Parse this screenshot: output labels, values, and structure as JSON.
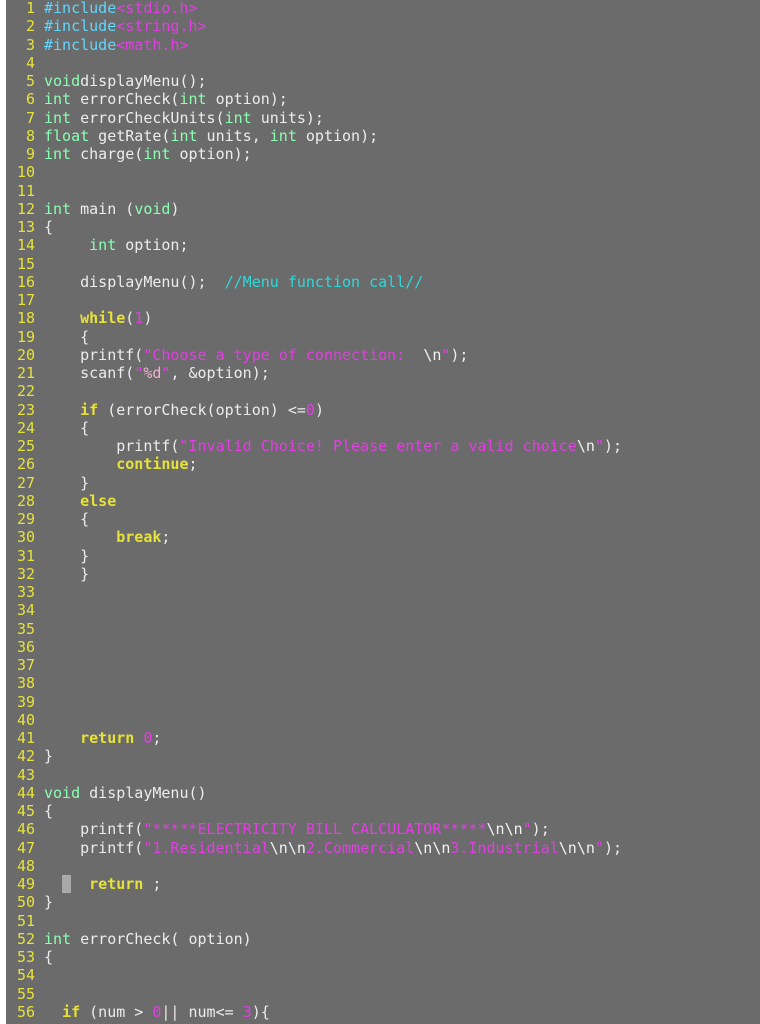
{
  "colors": {
    "background": "#6b6b6b",
    "line_number": "#e6e23a",
    "preprocessor": "#5fd7ff",
    "string": "#e23ee2",
    "type": "#8affb2",
    "statement": "#e6e23a",
    "comment": "#2ed8d8",
    "text": "#ececec"
  },
  "editor": {
    "lines": [
      {
        "n": "1",
        "s": [
          [
            "pp",
            "#include"
          ],
          [
            "str",
            "<stdio.h>"
          ]
        ]
      },
      {
        "n": "2",
        "s": [
          [
            "pp",
            "#include"
          ],
          [
            "str",
            "<string.h>"
          ]
        ]
      },
      {
        "n": "3",
        "s": [
          [
            "pp",
            "#include"
          ],
          [
            "str",
            "<math.h>"
          ]
        ]
      },
      {
        "n": "4",
        "s": []
      },
      {
        "n": "5",
        "s": [
          [
            "type",
            "void"
          ],
          [
            "",
            "displayMenu();"
          ]
        ]
      },
      {
        "n": "6",
        "s": [
          [
            "type",
            "int"
          ],
          [
            "",
            " errorCheck("
          ],
          [
            "type",
            "int"
          ],
          [
            "",
            " option);"
          ]
        ]
      },
      {
        "n": "7",
        "s": [
          [
            "type",
            "int"
          ],
          [
            "",
            " errorCheckUnits("
          ],
          [
            "type",
            "int"
          ],
          [
            "",
            " units);"
          ]
        ]
      },
      {
        "n": "8",
        "s": [
          [
            "type",
            "float"
          ],
          [
            "",
            " getRate("
          ],
          [
            "type",
            "int"
          ],
          [
            "",
            " units, "
          ],
          [
            "type",
            "int"
          ],
          [
            "",
            " option);"
          ]
        ]
      },
      {
        "n": "9",
        "s": [
          [
            "type",
            "int"
          ],
          [
            "",
            " charge("
          ],
          [
            "type",
            "int"
          ],
          [
            "",
            " option);"
          ]
        ]
      },
      {
        "n": "10",
        "s": []
      },
      {
        "n": "11",
        "s": []
      },
      {
        "n": "12",
        "s": [
          [
            "type",
            "int"
          ],
          [
            "",
            " main ("
          ],
          [
            "type",
            "void"
          ],
          [
            "",
            ")"
          ]
        ]
      },
      {
        "n": "13",
        "s": [
          [
            "",
            "{"
          ]
        ]
      },
      {
        "n": "14",
        "s": [
          [
            "",
            "     "
          ],
          [
            "type",
            "int"
          ],
          [
            "",
            " option;"
          ]
        ]
      },
      {
        "n": "15",
        "s": []
      },
      {
        "n": "16",
        "s": [
          [
            "",
            "    displayMenu();  "
          ],
          [
            "com",
            "//Menu function call//"
          ]
        ]
      },
      {
        "n": "17",
        "s": []
      },
      {
        "n": "18",
        "s": [
          [
            "",
            "    "
          ],
          [
            "kw",
            "while"
          ],
          [
            "",
            "("
          ],
          [
            "str",
            "1"
          ],
          [
            "",
            ")"
          ]
        ]
      },
      {
        "n": "19",
        "s": [
          [
            "",
            "    {"
          ]
        ]
      },
      {
        "n": "20",
        "s": [
          [
            "",
            "    printf("
          ],
          [
            "str",
            "\"Choose a type of connection:  "
          ],
          [
            "sp",
            "\\n"
          ],
          [
            "str",
            "\""
          ],
          [
            "",
            ");"
          ]
        ]
      },
      {
        "n": "21",
        "s": [
          [
            "",
            "    scanf("
          ],
          [
            "str",
            "\""
          ],
          [
            "fmt",
            "%d"
          ],
          [
            "str",
            "\""
          ],
          [
            "",
            ", &option);"
          ]
        ]
      },
      {
        "n": "22",
        "s": []
      },
      {
        "n": "23",
        "s": [
          [
            "",
            "    "
          ],
          [
            "kw",
            "if"
          ],
          [
            "",
            " (errorCheck(option) <="
          ],
          [
            "str",
            "0"
          ],
          [
            "",
            ")"
          ]
        ]
      },
      {
        "n": "24",
        "s": [
          [
            "",
            "    {"
          ]
        ]
      },
      {
        "n": "25",
        "s": [
          [
            "",
            "        printf("
          ],
          [
            "str",
            "\"Invalid Choice! Please enter a valid choice"
          ],
          [
            "sp",
            "\\n"
          ],
          [
            "str",
            "\""
          ],
          [
            "",
            ");"
          ]
        ]
      },
      {
        "n": "26",
        "s": [
          [
            "",
            "        "
          ],
          [
            "kw",
            "continue"
          ],
          [
            "",
            ";"
          ]
        ]
      },
      {
        "n": "27",
        "s": [
          [
            "",
            "    }"
          ]
        ]
      },
      {
        "n": "28",
        "s": [
          [
            "",
            "    "
          ],
          [
            "kw",
            "else"
          ]
        ]
      },
      {
        "n": "29",
        "s": [
          [
            "",
            "    {"
          ]
        ]
      },
      {
        "n": "30",
        "s": [
          [
            "",
            "        "
          ],
          [
            "kw",
            "break"
          ],
          [
            "",
            ";"
          ]
        ]
      },
      {
        "n": "31",
        "s": [
          [
            "",
            "    }"
          ]
        ]
      },
      {
        "n": "32",
        "s": [
          [
            "",
            "    }"
          ]
        ]
      },
      {
        "n": "33",
        "s": []
      },
      {
        "n": "34",
        "s": []
      },
      {
        "n": "35",
        "s": []
      },
      {
        "n": "36",
        "s": []
      },
      {
        "n": "37",
        "s": []
      },
      {
        "n": "38",
        "s": []
      },
      {
        "n": "39",
        "s": []
      },
      {
        "n": "40",
        "s": []
      },
      {
        "n": "41",
        "s": [
          [
            "",
            "    "
          ],
          [
            "kw",
            "return"
          ],
          [
            "",
            " "
          ],
          [
            "str",
            "0"
          ],
          [
            "",
            ";"
          ]
        ]
      },
      {
        "n": "42",
        "s": [
          [
            "",
            "}"
          ]
        ]
      },
      {
        "n": "43",
        "s": []
      },
      {
        "n": "44",
        "s": [
          [
            "type",
            "void"
          ],
          [
            "",
            " displayMenu()"
          ]
        ]
      },
      {
        "n": "45",
        "s": [
          [
            "",
            "{"
          ]
        ]
      },
      {
        "n": "46",
        "s": [
          [
            "",
            "    printf("
          ],
          [
            "str",
            "\"*****ELECTRICITY BILL CALCULATOR*****"
          ],
          [
            "sp",
            "\\n\\n"
          ],
          [
            "str",
            "\""
          ],
          [
            "",
            ");"
          ]
        ]
      },
      {
        "n": "47",
        "s": [
          [
            "",
            "    printf("
          ],
          [
            "str",
            "\"1.Residential"
          ],
          [
            "sp",
            "\\n\\n"
          ],
          [
            "str",
            "2.Commercial"
          ],
          [
            "sp",
            "\\n\\n"
          ],
          [
            "str",
            "3.Industrial"
          ],
          [
            "sp",
            "\\n\\n"
          ],
          [
            "str",
            "\""
          ],
          [
            "",
            ");"
          ]
        ]
      },
      {
        "n": "48",
        "s": []
      },
      {
        "n": "49",
        "s": [
          [
            "",
            "  "
          ],
          [
            "cur",
            " "
          ],
          [
            "",
            "  "
          ],
          [
            "kw",
            "return"
          ],
          [
            "",
            " ;"
          ]
        ]
      },
      {
        "n": "50",
        "s": [
          [
            "",
            "}"
          ]
        ]
      },
      {
        "n": "51",
        "s": []
      },
      {
        "n": "52",
        "s": [
          [
            "type",
            "int"
          ],
          [
            "",
            " errorCheck( option)"
          ]
        ]
      },
      {
        "n": "53",
        "s": [
          [
            "",
            "{"
          ]
        ]
      },
      {
        "n": "54",
        "s": []
      },
      {
        "n": "55",
        "s": []
      },
      {
        "n": "56",
        "s": [
          [
            "",
            "  "
          ],
          [
            "kw",
            "if"
          ],
          [
            "",
            " (num > "
          ],
          [
            "str",
            "0"
          ],
          [
            "",
            "|| num<= "
          ],
          [
            "str",
            "3"
          ],
          [
            "",
            "){"
          ]
        ]
      }
    ]
  }
}
